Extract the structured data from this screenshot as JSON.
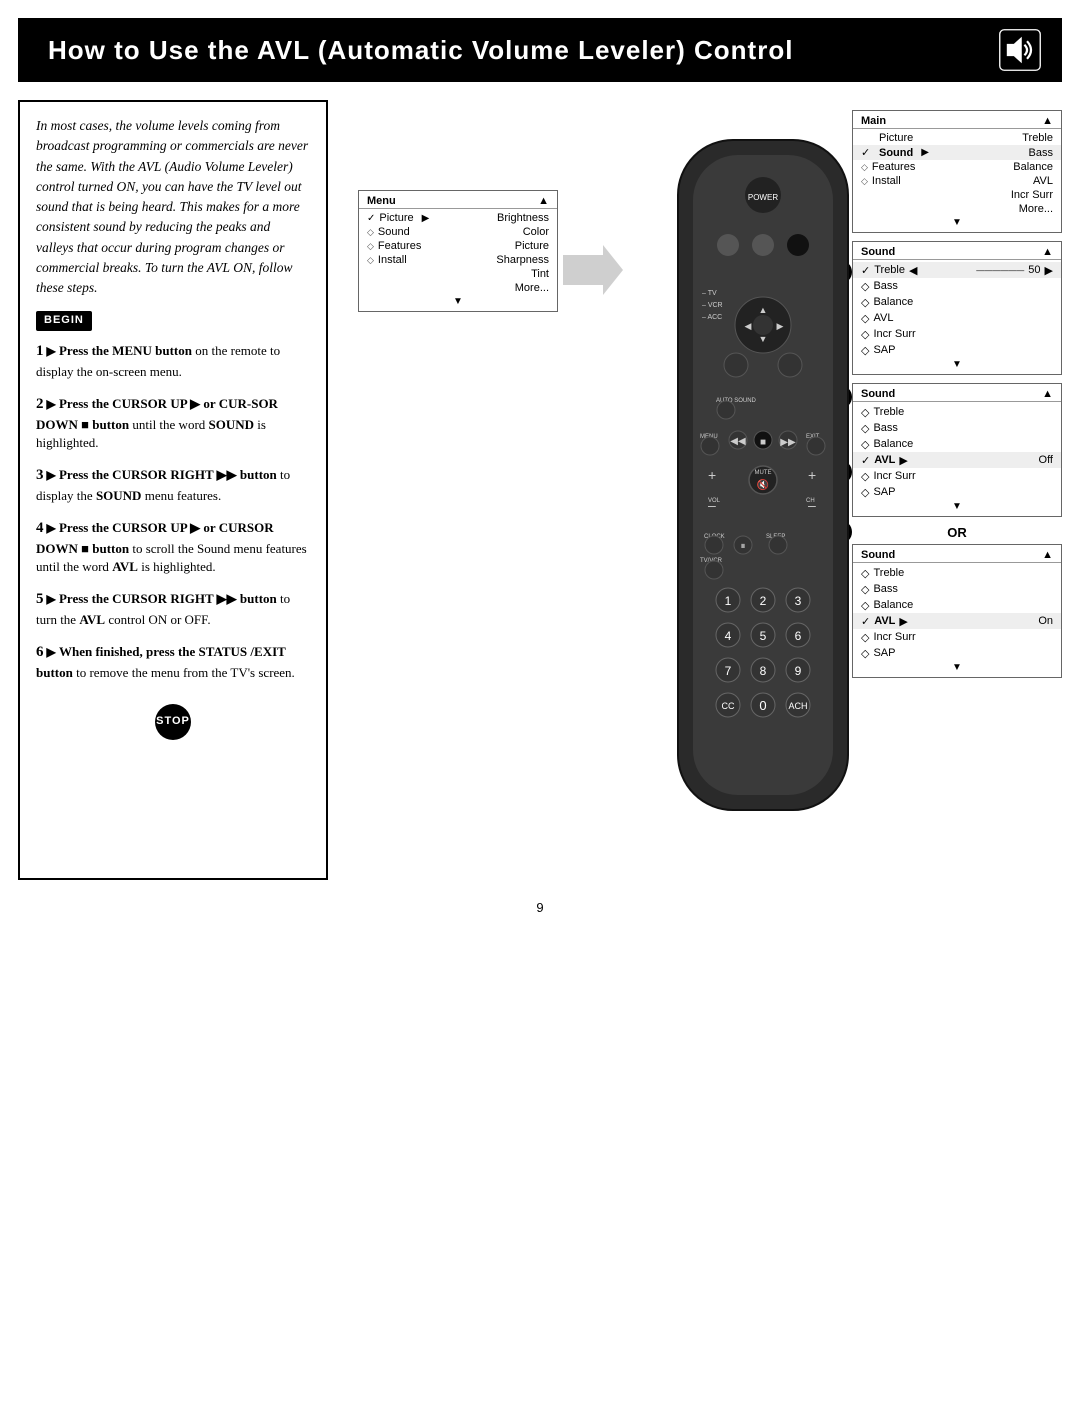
{
  "header": {
    "title": "How to Use the AVL (Automatic Volume Leveler) Control",
    "icon": "speaker"
  },
  "intro": {
    "text": "In most cases, the volume levels coming from broadcast programming or commercials are never the same. With the AVL (Audio Volume Leveler) control turned ON, you can have the TV level out sound that is being heard. This makes for a more consistent sound by reducing the peaks and valleys that occur during program changes or commercial breaks. To turn the AVL ON, follow these steps."
  },
  "begin_label": "BEGIN",
  "stop_label": "STOP",
  "steps": [
    {
      "num": "1",
      "text": "Press the MENU button on the remote to display the on-screen menu."
    },
    {
      "num": "2",
      "text": "Press the CURSOR UP ▶ or CURSOR DOWN ■ button until the word SOUND is highlighted."
    },
    {
      "num": "3",
      "text": "Press the CURSOR RIGHT ▶▶ button to display the SOUND menu features."
    },
    {
      "num": "4",
      "text": "Press the CURSOR UP ▶ or CURSOR DOWN ■ button to scroll the Sound menu features until the word AVL is highlighted."
    },
    {
      "num": "5",
      "text": "Press the CURSOR RIGHT ▶▶ button to turn the AVL control ON or OFF."
    },
    {
      "num": "6",
      "text": "When finished, press the STATUS /EXIT button to remove the menu from the TV's screen."
    }
  ],
  "menus": {
    "main_menu": {
      "title": "Menu",
      "items": [
        {
          "label": "Picture",
          "check": "✓",
          "sub": "Brightness"
        },
        {
          "label": "Sound",
          "diamond": "◇",
          "sub": "Color"
        },
        {
          "label": "Features",
          "diamond": "◇",
          "sub": "Picture"
        },
        {
          "label": "Install",
          "diamond": "◇",
          "sub": "Sharpness"
        },
        {
          "label": "",
          "sub": "Tint"
        },
        {
          "label": "",
          "sub": "More..."
        }
      ]
    },
    "main_sound_menu": {
      "title": "Main",
      "items": [
        {
          "label": "Picture",
          "marker": ""
        },
        {
          "label": "Sound",
          "marker": "✓",
          "sub": "Bass"
        },
        {
          "label": "Features",
          "marker": "◇"
        },
        {
          "label": "Install",
          "marker": "◇"
        }
      ],
      "sub_items": [
        "Treble",
        "Bass",
        "Balance",
        "AVL",
        "Incr Surr",
        "More..."
      ]
    },
    "sound_treble": {
      "title": "Sound",
      "items": [
        {
          "label": "Treble",
          "marker": "✓",
          "value": "50",
          "has_slider": true
        },
        {
          "label": "Bass",
          "marker": "◇"
        },
        {
          "label": "Balance",
          "marker": "◇"
        },
        {
          "label": "AVL",
          "marker": "◇"
        },
        {
          "label": "Incr Surr",
          "marker": "◇"
        },
        {
          "label": "SAP",
          "marker": "◇"
        }
      ]
    },
    "sound_avl_off": {
      "title": "Sound",
      "items": [
        {
          "label": "Treble",
          "marker": "◇"
        },
        {
          "label": "Bass",
          "marker": "◇"
        },
        {
          "label": "Balance",
          "marker": "◇"
        },
        {
          "label": "AVL",
          "marker": "✓",
          "value": "Off"
        },
        {
          "label": "Incr Surr",
          "marker": "◇"
        },
        {
          "label": "SAP",
          "marker": "◇"
        }
      ]
    },
    "sound_avl_on": {
      "title": "Sound",
      "items": [
        {
          "label": "Treble",
          "marker": "◇"
        },
        {
          "label": "Bass",
          "marker": "◇"
        },
        {
          "label": "Balance",
          "marker": "◇"
        },
        {
          "label": "AVL",
          "marker": "✓",
          "value": "On"
        },
        {
          "label": "Incr Surr",
          "marker": "◇"
        },
        {
          "label": "SAP",
          "marker": "◇"
        }
      ]
    }
  },
  "or_label": "OR",
  "page_number": "9"
}
